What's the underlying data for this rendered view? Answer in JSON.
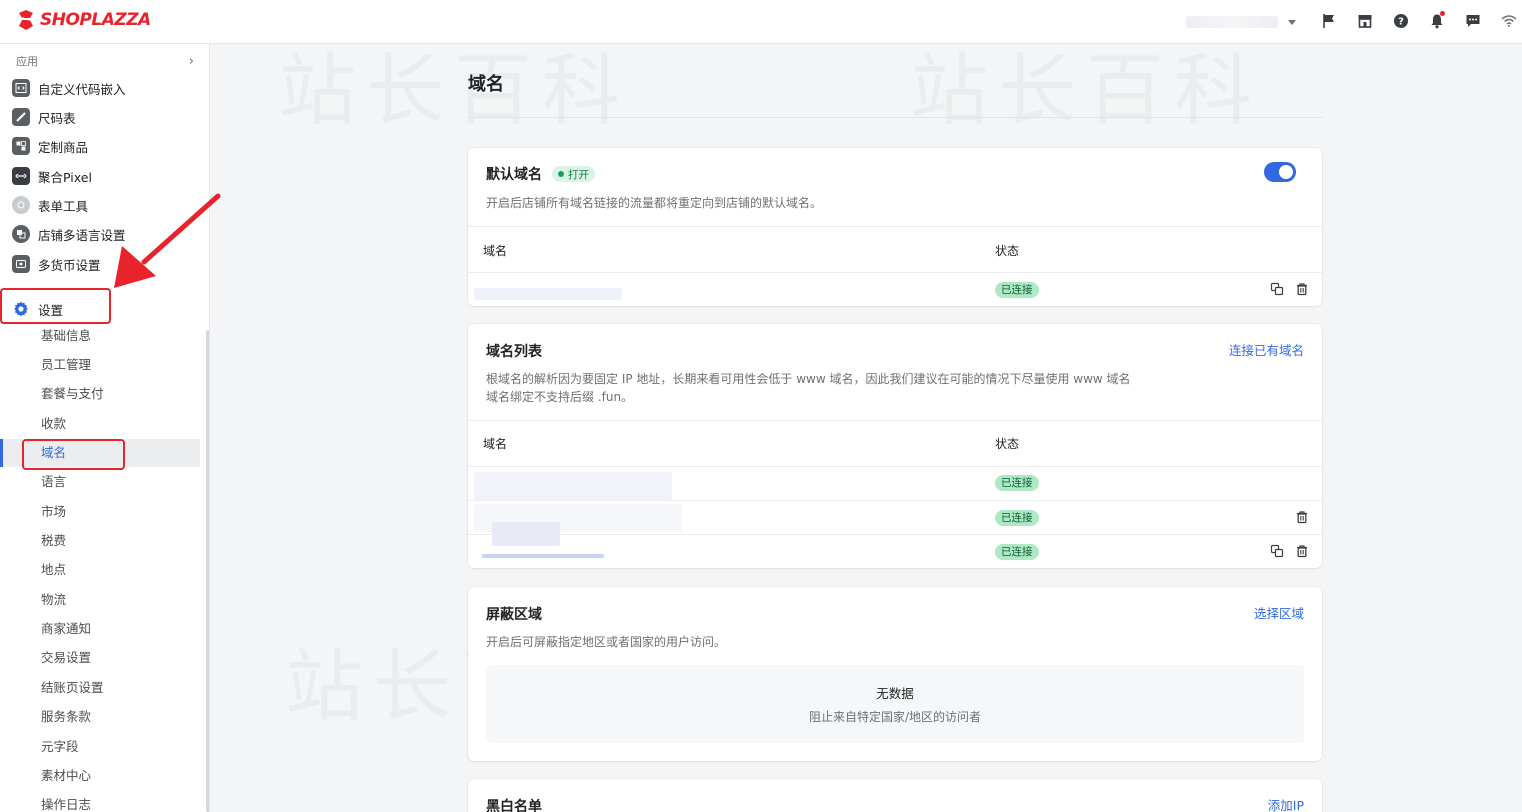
{
  "brand": {
    "name": "SHOPLAZZA",
    "color": "#e8232b"
  },
  "accent": "#3169e0",
  "topbar": {
    "icons": [
      "flag-icon",
      "store-icon",
      "help-icon",
      "bell-icon",
      "chat-icon",
      "wifi-icon"
    ]
  },
  "sidebar": {
    "section_label": "应用",
    "apps": [
      {
        "label": "自定义代码嵌入",
        "icon": "code-icon"
      },
      {
        "label": "尺码表",
        "icon": "ruler-icon"
      },
      {
        "label": "定制商品",
        "icon": "custom-product-icon"
      },
      {
        "label": "聚合Pixel",
        "icon": "pixel-icon"
      },
      {
        "label": "表单工具",
        "icon": "form-icon"
      },
      {
        "label": "店铺多语言设置",
        "icon": "language-icon"
      },
      {
        "label": "多货币设置",
        "icon": "currency-icon"
      }
    ],
    "settings_label": "设置",
    "sub_items": [
      "基础信息",
      "员工管理",
      "套餐与支付",
      "收款",
      "域名",
      "语言",
      "市场",
      "税费",
      "地点",
      "物流",
      "商家通知",
      "交易设置",
      "结账页设置",
      "服务条款",
      "元字段",
      "素材中心",
      "操作日志"
    ],
    "active_index": 4
  },
  "page": {
    "title": "域名"
  },
  "default_domain": {
    "title": "默认域名",
    "badge": "打开",
    "desc": "开启后店铺所有域名链接的流量都将重定向到店铺的默认域名。",
    "col_domain": "域名",
    "col_status": "状态",
    "rows": [
      {
        "status": "已连接"
      }
    ],
    "toggle_on": true
  },
  "domain_list": {
    "title": "域名列表",
    "link": "连接已有域名",
    "desc_line1": "根域名的解析因为要固定 IP 地址，长期来看可用性会低于 www 域名，因此我们建议在可能的情况下尽量使用 www 域名",
    "desc_line2": "域名绑定不支持后缀 .fun。",
    "col_domain": "域名",
    "col_status": "状态",
    "rows": [
      {
        "status": "已连接"
      },
      {
        "status": "已连接"
      },
      {
        "status": "已连接"
      }
    ]
  },
  "blocked_region": {
    "title": "屏蔽区域",
    "link": "选择区域",
    "desc": "开启后可屏蔽指定地区或者国家的用户访问。",
    "empty_title": "无数据",
    "empty_sub": "阻止来自特定国家/地区的访问者"
  },
  "whitelist": {
    "title": "黑白名单",
    "link": "添加IP"
  },
  "watermark": "站长百科"
}
